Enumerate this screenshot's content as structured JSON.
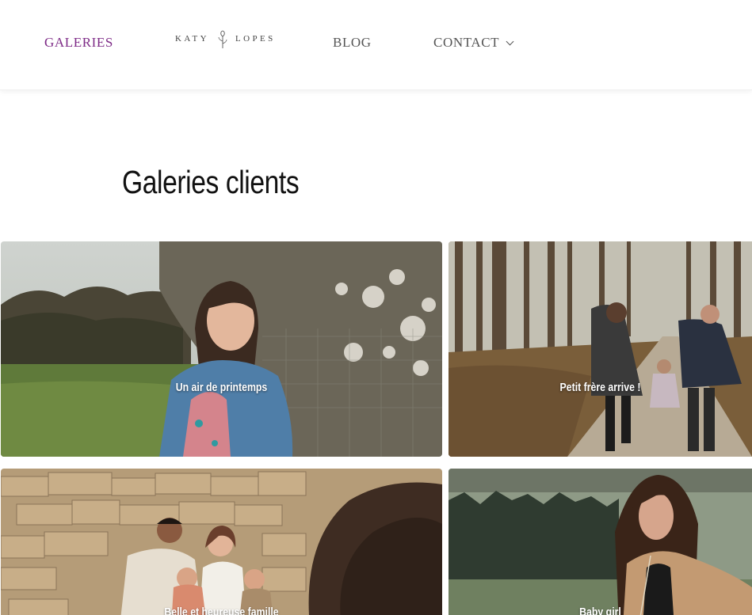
{
  "nav": {
    "galeries": "GALERIES",
    "blog": "BLOG",
    "contact": "CONTACT",
    "active_color": "#7d2a86",
    "logo": {
      "left_word": "KATY",
      "right_word": "LOPES"
    }
  },
  "page": {
    "title": "Galeries clients"
  },
  "galleries": [
    {
      "label": "Un air de printemps"
    },
    {
      "label": "Petit frère arrive !"
    },
    {
      "label": "Belle et heureuse famille"
    },
    {
      "label": "Baby girl"
    }
  ]
}
